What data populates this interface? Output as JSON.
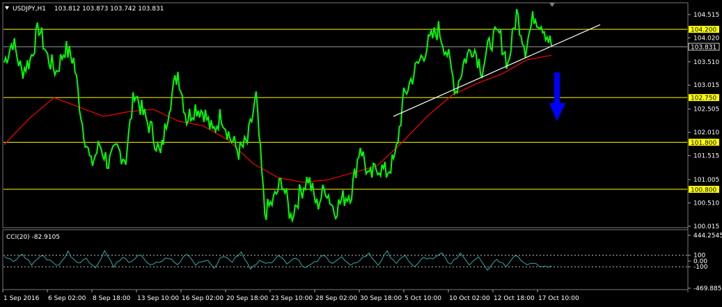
{
  "header": {
    "symbol": "USDJPY,H1",
    "ohlc": "103.812 103.873 103.742 103.831"
  },
  "cci_header": "CCI(20) -82.9105",
  "colors": {
    "background": "#000000",
    "price_line": "#00ff00",
    "moving_average": "#ff0000",
    "level_line": "#ffff00",
    "trend_line": "#ffffff",
    "arrow": "#0000ff",
    "cci_line": "#33aaaa",
    "current_price_line": "#a0a0a0"
  },
  "icons": {
    "menu_marker": "triangle-down-icon",
    "scroll_marker": "triangle-down-icon",
    "forecast_arrow": "arrow-down-icon"
  },
  "chart_data": [
    {
      "type": "line",
      "title": "USDJPY,H1",
      "ylim": [
        100.0,
        104.75
      ],
      "y_ticks": [
        "104.515",
        "104.020",
        "103.510",
        "103.015",
        "102.505",
        "102.010",
        "101.515",
        "101.005",
        "100.510",
        "100.015"
      ],
      "x_ticks": [
        "1 Sep 2016",
        "6 Sep 02:00",
        "8 Sep 18:00",
        "13 Sep 10:00",
        "16 Sep 02:00",
        "20 Sep 18:00",
        "23 Sep 10:00",
        "28 Sep 02:00",
        "30 Sep 18:00",
        "5 Oct 10:00",
        "10 Oct 02:00",
        "12 Oct 18:00",
        "17 Oct 10:00"
      ],
      "level_lines": [
        {
          "value": 104.2,
          "label": "104.200"
        },
        {
          "value": 102.75,
          "label": "102.750"
        },
        {
          "value": 101.8,
          "label": "101.800"
        },
        {
          "value": 100.8,
          "label": "100.800"
        }
      ],
      "current_price": {
        "value": 103.831,
        "label": "103.831"
      },
      "series": [
        {
          "values": [
            103.5,
            103.95,
            103.3,
            103.55,
            104.25,
            103.6,
            103.3,
            103.8,
            103.55,
            102.2,
            101.3,
            101.75,
            101.35,
            101.65,
            101.45,
            102.9,
            102.4,
            102.05,
            101.5,
            102.6,
            103.3,
            102.3,
            102.55,
            102.45,
            102.0,
            102.4,
            101.9,
            101.6,
            101.8,
            102.75,
            100.3,
            100.55,
            101.0,
            100.2,
            100.7,
            101.05,
            100.45,
            100.85,
            100.35,
            100.6,
            100.75,
            101.75,
            101.0,
            101.3,
            101.15,
            101.45,
            102.75,
            103.2,
            103.6,
            103.95,
            104.2,
            103.7,
            102.9,
            103.55,
            103.85,
            103.35,
            103.95,
            104.1,
            103.45,
            104.55,
            103.8,
            104.5,
            104.3,
            103.85
          ]
        },
        {
          "values": [
            101.75,
            102.3,
            102.75,
            102.55,
            102.35,
            102.45,
            102.5,
            102.25,
            102.15,
            101.85,
            101.35,
            101.05,
            100.95,
            101.0,
            101.15,
            101.3,
            101.8,
            102.35,
            102.8,
            103.05,
            103.25,
            103.55,
            103.65
          ]
        }
      ],
      "trend_line": {
        "from": 102.35,
        "to": 104.3
      }
    },
    {
      "type": "line",
      "title": "CCI(20) -82.9105",
      "ylim": [
        -469.8855,
        444.2545
      ],
      "y_ticks": [
        "444.2545",
        "100",
        "0.00",
        "-100",
        "-469.8855"
      ],
      "reference_levels": [
        100,
        -100
      ],
      "series": [
        {
          "values": [
            80,
            -20,
            120,
            -60,
            90,
            20,
            -90,
            160,
            -40,
            60,
            -130,
            180,
            -80,
            50,
            -30,
            120,
            -90,
            -20,
            60,
            -70,
            140,
            -50,
            30,
            -110,
            90,
            -20,
            180,
            -160,
            40,
            -60,
            110,
            -30,
            70,
            -120,
            -40,
            90,
            -20,
            60,
            -100,
            30,
            120,
            -60,
            150,
            -30,
            80,
            -110,
            60,
            20,
            130,
            -70,
            140,
            -50,
            90,
            -140,
            40,
            -80,
            120,
            -30,
            -60,
            -100,
            -83
          ]
        }
      ]
    }
  ]
}
